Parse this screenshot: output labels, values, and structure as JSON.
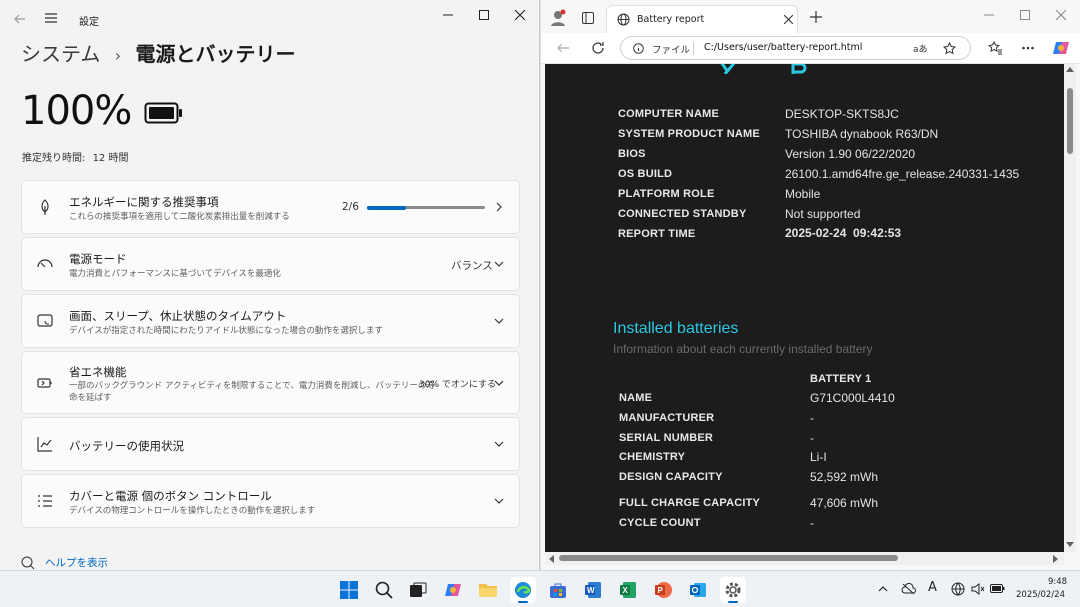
{
  "settings": {
    "back_icon": "arrow-left-icon",
    "app_title": "設定",
    "breadcrumb_root": "システム",
    "breadcrumb_sep": "›",
    "breadcrumb_current": "電源とバッテリー",
    "battery_percent": "100%",
    "battery_level": 1.0,
    "remaining_label": "推定残り時間:",
    "remaining_value": "12 時間",
    "cards": [
      {
        "title": "エネルギーに関する推奨事項",
        "subtitle": "これらの推奨事項を適用して二酸化炭素排出量を削減する",
        "progress_text": "2/6",
        "progress_fraction": 0.333,
        "icon": "leaf-icon"
      },
      {
        "title": "電源モード",
        "subtitle": "電力消費とパフォーマンスに基づいてデバイスを最適化",
        "value": "バランス",
        "icon": "gauge-icon"
      },
      {
        "title": "画面、スリープ、休止状態のタイムアウト",
        "subtitle": "デバイスが指定された時間にわたりアイドル状態になった場合の動作を選択します",
        "icon": "screen-sleep-icon"
      },
      {
        "title": "省エネ機能",
        "subtitle_line1": "一部のバックグラウンド アクティビティを制限することで、電力消費を削減し、バッテリーの寿",
        "subtitle_line2": "命を延ばす",
        "value": "30% でオンにする",
        "icon": "battery-saver-icon"
      },
      {
        "title": "バッテリーの使用状況",
        "icon": "chart-icon"
      },
      {
        "title": "カバーと電源 個のボタン コントロール",
        "subtitle": "デバイスの物理コントロールを操作したときの動作を選択します",
        "icon": "list-icon"
      }
    ],
    "help_link": "ヘルプを表示"
  },
  "edge": {
    "tab_title": "Battery report",
    "address_scheme": "ファイル",
    "address_url": "C:/Users/user/battery-report.html",
    "read_aloud": "aあ"
  },
  "report": {
    "system_rows": [
      {
        "key": "COMPUTER NAME",
        "value": "DESKTOP-SKTS8JC"
      },
      {
        "key": "SYSTEM PRODUCT NAME",
        "value": "TOSHIBA dynabook R63/DN"
      },
      {
        "key": "BIOS",
        "value": "Version 1.90 06/22/2020"
      },
      {
        "key": "OS BUILD",
        "value": "26100.1.amd64fre.ge_release.240331-1435"
      },
      {
        "key": "PLATFORM ROLE",
        "value": "Mobile"
      },
      {
        "key": "CONNECTED STANDBY",
        "value": "Not supported"
      },
      {
        "key": "REPORT TIME",
        "value": "2025-02-24  09:42:53"
      }
    ],
    "section_title": "Installed batteries",
    "section_subtitle": "Information about each currently installed battery",
    "battery_header": "BATTERY 1",
    "battery_rows": [
      {
        "key": "NAME",
        "value": "G71C000L4410"
      },
      {
        "key": "MANUFACTURER",
        "value": "-"
      },
      {
        "key": "SERIAL NUMBER",
        "value": "-"
      },
      {
        "key": "CHEMISTRY",
        "value": "Li-I"
      },
      {
        "key": "DESIGN CAPACITY",
        "value": "52,592 mWh"
      },
      {
        "key": "FULL CHARGE CAPACITY",
        "value": "47,606 mWh"
      },
      {
        "key": "CYCLE COUNT",
        "value": "-"
      }
    ]
  },
  "taskbar": {
    "time": "9:48",
    "date": "2025/02/24",
    "ime_label": "A"
  },
  "colors": {
    "accent": "#0067c0",
    "report_bg": "#1c1c1c",
    "report_heading": "#2cc8e0"
  }
}
